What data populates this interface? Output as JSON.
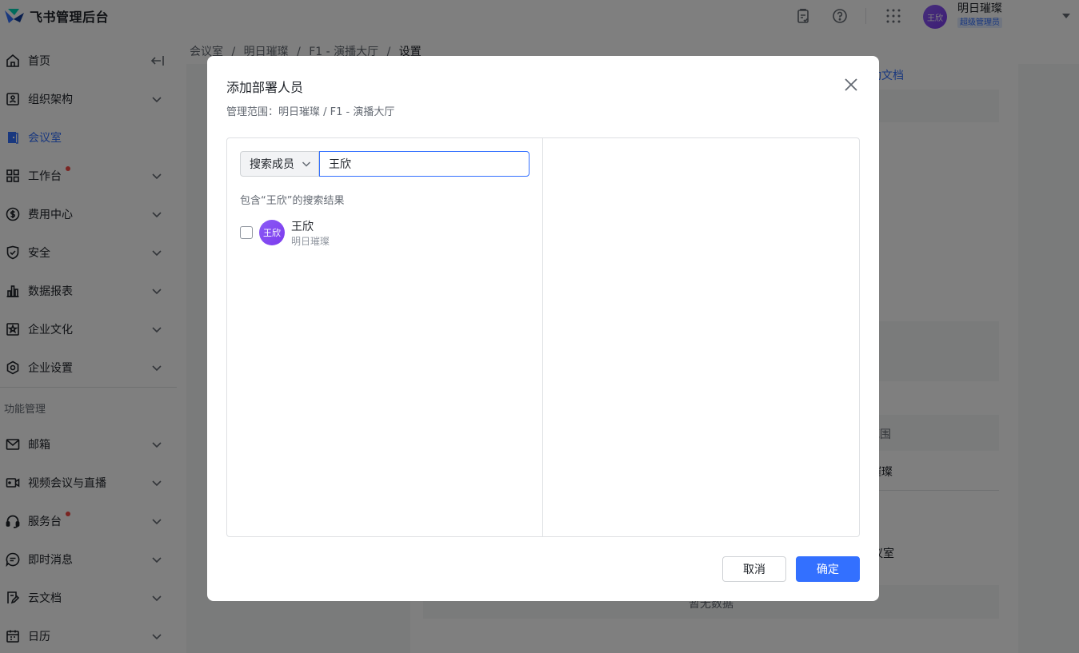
{
  "app": {
    "title": "飞书管理后台"
  },
  "header": {
    "user": {
      "avatar_text": "王欣",
      "name": "明日璀璨",
      "role": "超级管理员"
    },
    "icons": [
      "clipboard-check-icon",
      "help-circle-icon",
      "app-grid-icon",
      "caret-down-icon"
    ]
  },
  "sidebar": {
    "collapse_icon": "collapse-sidebar-icon",
    "items": [
      {
        "label": "首页",
        "icon": "home-icon"
      },
      {
        "label": "组织架构",
        "icon": "org-icon"
      },
      {
        "label": "会议室",
        "icon": "meeting-room-icon",
        "active": true
      },
      {
        "label": "工作台",
        "icon": "workbench-icon",
        "badge": true
      },
      {
        "label": "费用中心",
        "icon": "billing-icon"
      },
      {
        "label": "安全",
        "icon": "shield-icon"
      },
      {
        "label": "数据报表",
        "icon": "bar-chart-icon"
      },
      {
        "label": "企业文化",
        "icon": "culture-icon"
      },
      {
        "label": "企业设置",
        "icon": "settings-icon"
      }
    ],
    "section_title": "功能管理",
    "feature_items": [
      {
        "label": "邮箱",
        "icon": "mail-icon"
      },
      {
        "label": "视频会议与直播",
        "icon": "video-icon"
      },
      {
        "label": "服务台",
        "icon": "headset-icon",
        "badge": true
      },
      {
        "label": "即时消息",
        "icon": "chat-icon"
      },
      {
        "label": "云文档",
        "icon": "doc-icon"
      },
      {
        "label": "日历",
        "icon": "calendar-icon"
      }
    ]
  },
  "breadcrumb": [
    "会议室",
    "明日璀璨",
    "F1 - 演播大厅",
    "设置"
  ],
  "background_fragments": {
    "doc_link": "动文档",
    "scope_label": "范围",
    "company": "璀璨",
    "room": "议室",
    "empty": "暂无数据"
  },
  "modal": {
    "title": "添加部署人员",
    "subtitle": "管理范围：明日璀璨 / F1 - 演播大厅",
    "search_type": "搜索成员",
    "search_value": "王欣",
    "result_hint": "包含“王欣”的搜索结果",
    "results": [
      {
        "name": "王欣",
        "department": "明日璀璨",
        "avatar_text": "王欣"
      }
    ],
    "cancel_label": "取消",
    "ok_label": "确定"
  },
  "colors": {
    "accent": "#3370ff",
    "avatar": "#7c3aed",
    "badge": "#f54a45"
  }
}
